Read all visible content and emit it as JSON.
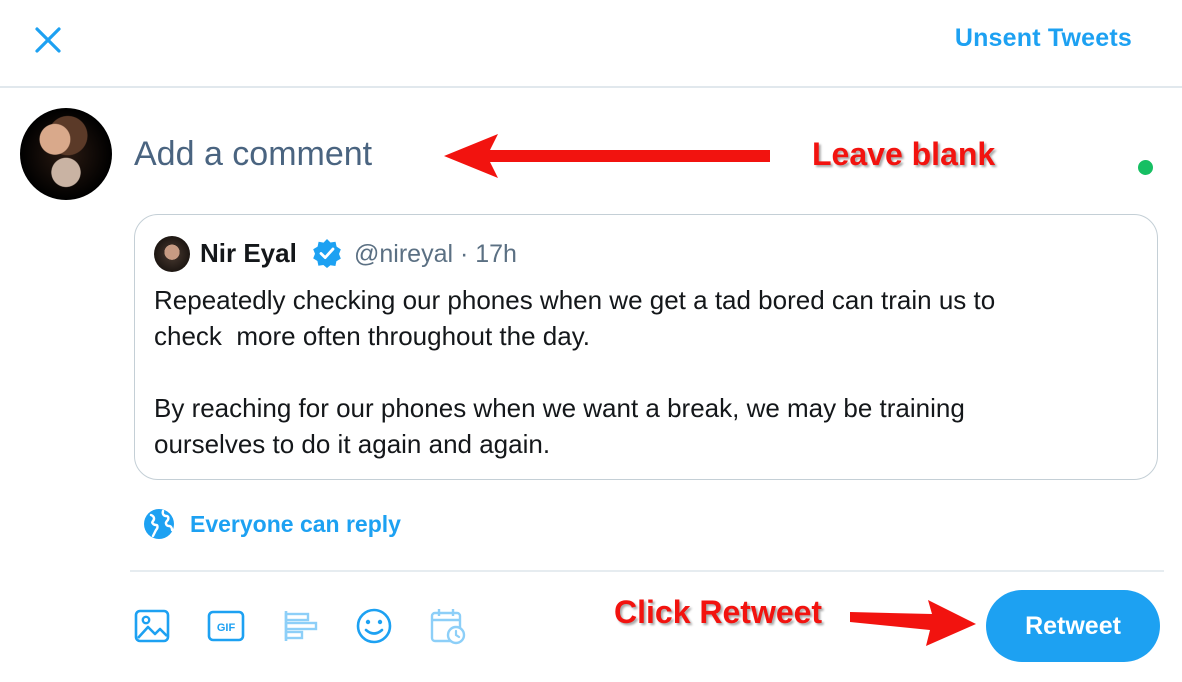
{
  "header": {
    "close_icon": "close-icon",
    "unsent_label": "Unsent Tweets"
  },
  "composer": {
    "placeholder": "Add a comment",
    "avatar_icon": "user-avatar",
    "status_color": "#17bf63"
  },
  "quoted_tweet": {
    "author_name": "Nir Eyal",
    "verified_icon": "verified-badge-icon",
    "meta": "@nireyal · 17h",
    "paragraph_1": "Repeatedly checking our phones when we get a tad bored can train us to\ncheck  more often throughout the day.",
    "paragraph_2": "By reaching for our phones when we want a break, we may be training\nourselves to do it again and again."
  },
  "reply_setting": {
    "icon": "globe-icon",
    "label": "Everyone can reply"
  },
  "toolbar": {
    "icons": [
      "image-icon",
      "gif-icon",
      "poll-icon",
      "emoji-icon",
      "schedule-icon"
    ],
    "retweet_label": "Retweet"
  },
  "annotations": {
    "leave_blank": "Leave blank",
    "click_retweet": "Click Retweet"
  },
  "colors": {
    "accent": "#1da1f2",
    "annotation": "#f2130f",
    "text_secondary": "#5b7083"
  }
}
